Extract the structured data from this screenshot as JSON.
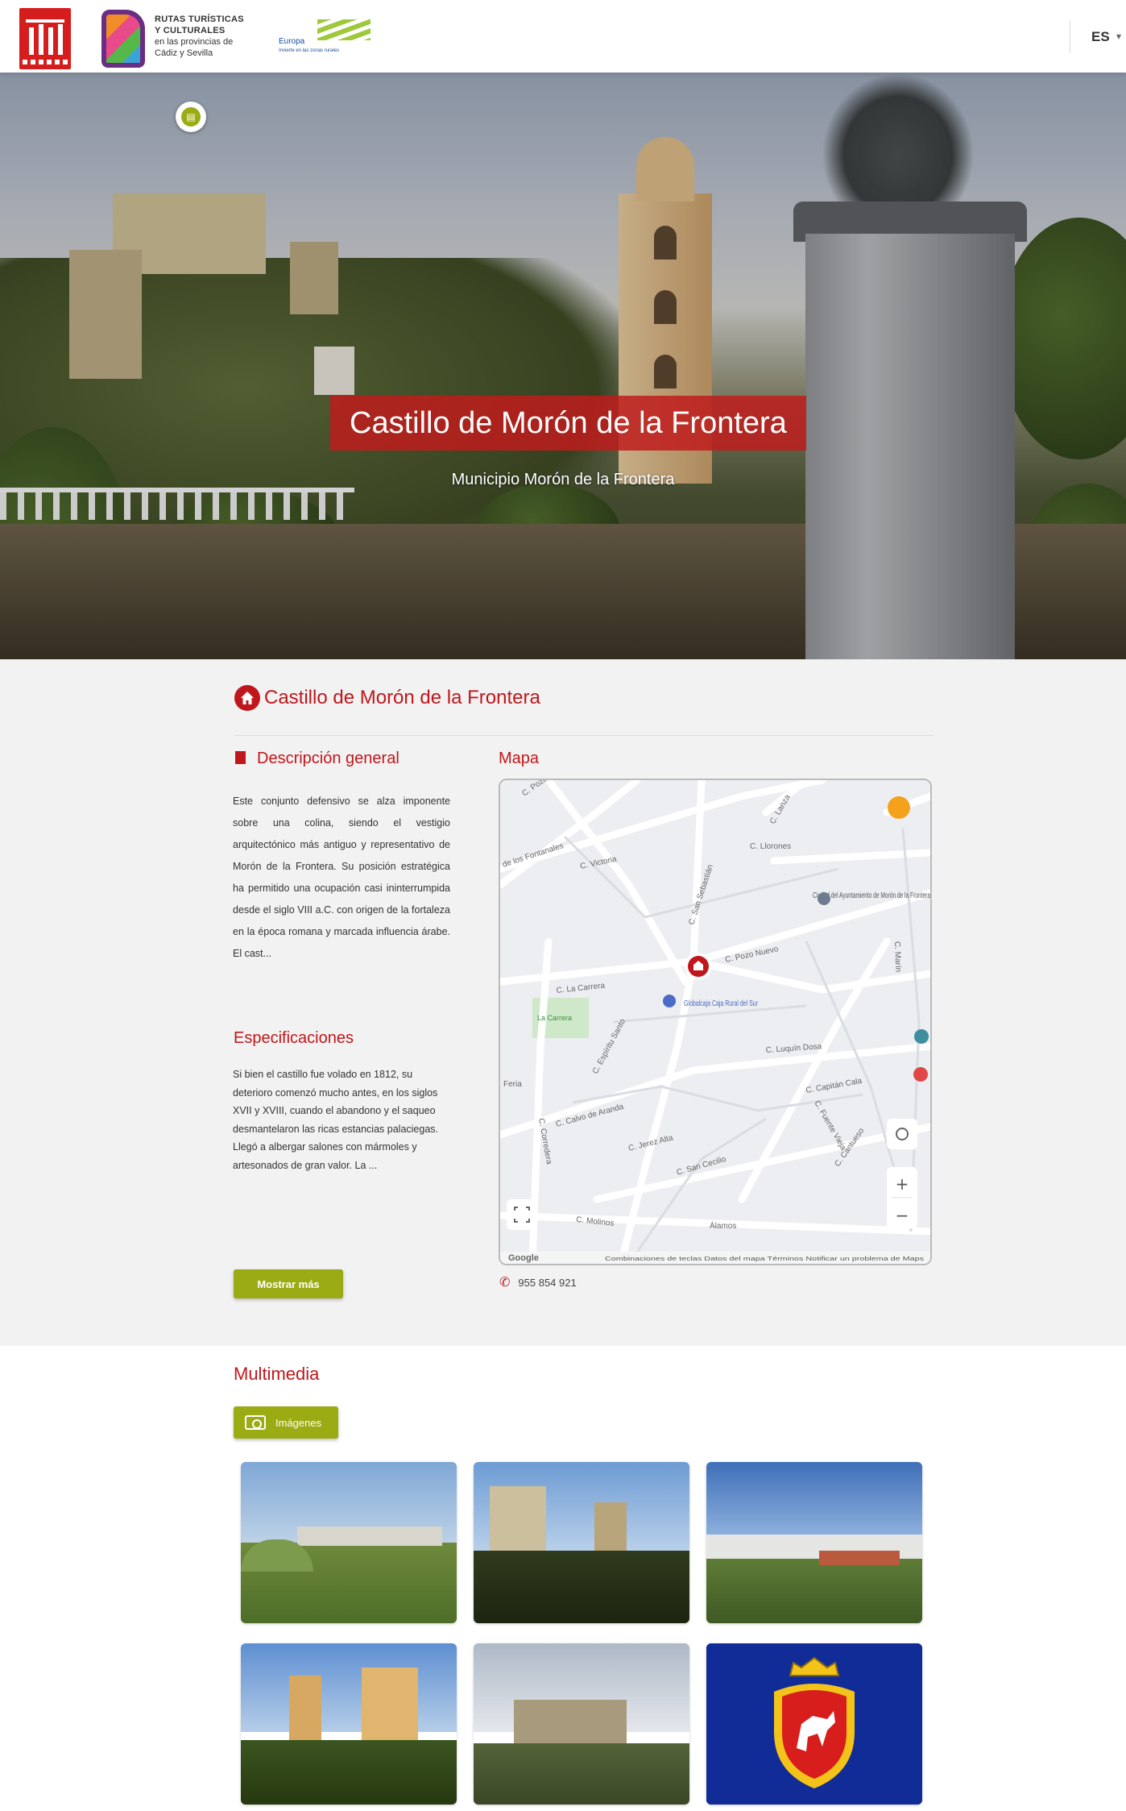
{
  "header": {
    "logo_rutas_line1": "RUTAS TURÍSTICAS",
    "logo_rutas_line2": "Y CULTURALES",
    "logo_rutas_line3": "en las provincias de",
    "logo_rutas_line4": "Cádiz y Sevilla",
    "logo_eu_line1": "Europa",
    "logo_eu_line2": "Invierte en las zonas rurales",
    "lang": "ES"
  },
  "hero": {
    "title": "Castillo de Morón de la Frontera",
    "subtitle": "Municipio Morón de la Frontera"
  },
  "info": {
    "title": "Castillo de Morón de la Frontera",
    "description_heading": "Descripción general",
    "description_text": "Este conjunto defensivo se alza imponente sobre una colina, siendo el vestigio arquitectónico más antiguo y representativo de Morón de la Frontera. Su posición estratégica ha permitido una ocupación casi ininterrumpida desde el siglo VIII a.C. con origen de la fortaleza en la época romana y marcada influencia árabe. El cast...",
    "specs_heading": "Especificaciones",
    "specs_text": "Si bien el castillo fue volado en 1812, su deterioro comenzó mucho antes, en los siglos XVII y XVIII, cuando el abandono y el saqueo desmantelaron las ricas estancias palaciegas. Llegó a albergar salones con mármoles y artesonados de gran valor. La ...",
    "more_button": "Mostrar más",
    "map_heading": "Mapa",
    "phone": "955 854 921"
  },
  "map": {
    "streets": [
      "C. Pozo",
      "de los Fontanales",
      "C. Lanza",
      "C. Victoria",
      "C. San Sebastián",
      "C. La Carrera",
      "C. Pozo Nuevo",
      "C. Llorones",
      "C. Espíritu Santo",
      "C. Corredera",
      "C. Calvo de Aranda",
      "C. Jerez Alta",
      "C. Capitán Cala",
      "C. Luquín Dosa",
      "C. San Cecilio",
      "C. Molinos",
      "Álamos",
      "C. Fuente Vieja",
      "C. Marín",
      "C. Cantueso",
      "Feria"
    ],
    "poi_ayuntamiento": "Ciudad del Ayuntamiento de Morón de la Frontera",
    "poi_caja": "Globalcaja Caja Rural del Sur",
    "poi_carrera": "La Carrera",
    "footer_text": "Combinaciones de teclas   Datos del mapa   Términos   Notificar un problema de Maps",
    "google": "Google",
    "zoom_in": "+",
    "zoom_out": "−"
  },
  "multimedia": {
    "heading": "Multimedia",
    "images_button": "Imágenes"
  }
}
